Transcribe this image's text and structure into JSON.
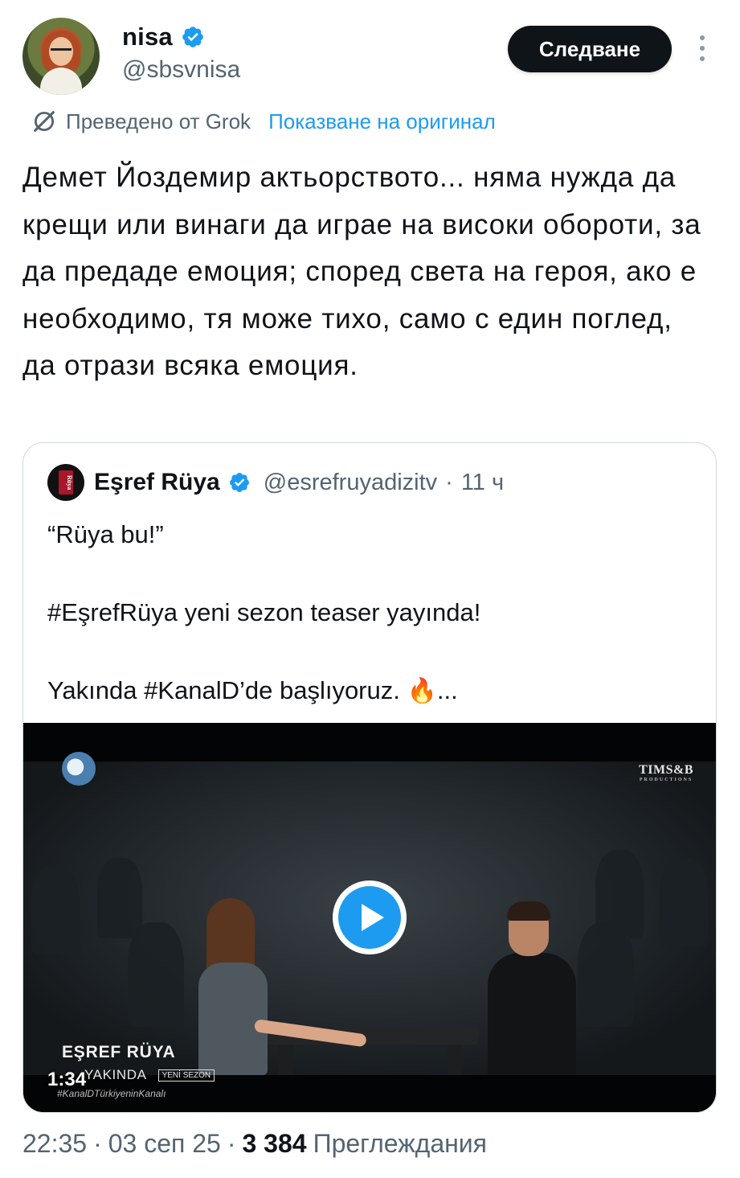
{
  "author": {
    "display_name": "nisa",
    "handle": "@sbsvnisa",
    "verified": true,
    "avatar_icon": "profile-photo"
  },
  "follow_button": {
    "label": "Следване"
  },
  "more_icon": "more-vertical-icon",
  "translation": {
    "translated_by": "Преведено от Grok",
    "show_original": "Показване на оригинал",
    "icon": "grok-icon"
  },
  "tweet_text": "Демет Йоздемир актьорството... няма нужда да крещи или винаги да играе на високи обороти, за да предаде емоция; според света на героя, ако е необходимо, тя може тихо, само с един поглед, да отрази всяка емоция.",
  "quote": {
    "display_name": "Eşref Rüya",
    "handle": "@esrefruyadizitv",
    "separator": "·",
    "time": "11 ч",
    "text": "“Rüya bu!”\n\n#EşrefRüya yeni sezon teaser yayında!\n\nYakında #KanalD’de başlıyoruz.",
    "emoji": "🔥",
    "ellipsis": "...",
    "avatar_logo_text": "Rüya",
    "video": {
      "duration": "1:34",
      "overlay_title": "EŞREF RÜYA",
      "overlay_subtitle": "YAKINDA",
      "overlay_badge": "YENİ SEZON",
      "overlay_tag": "#KanalDTürkiyeninKanalı",
      "production_logo": "TIMS&B",
      "production_sub": "PRODUCTIONS",
      "play_icon": "play-icon"
    }
  },
  "meta": {
    "time": "22:35",
    "sep1": "·",
    "date": "03 сеп 25",
    "sep2": "·",
    "views_count": "3 384",
    "views_label": "Преглеждания"
  },
  "colors": {
    "accent": "#1d9bf0",
    "text_primary": "#0f1419",
    "text_secondary": "#536471",
    "border": "#cfd9de"
  }
}
